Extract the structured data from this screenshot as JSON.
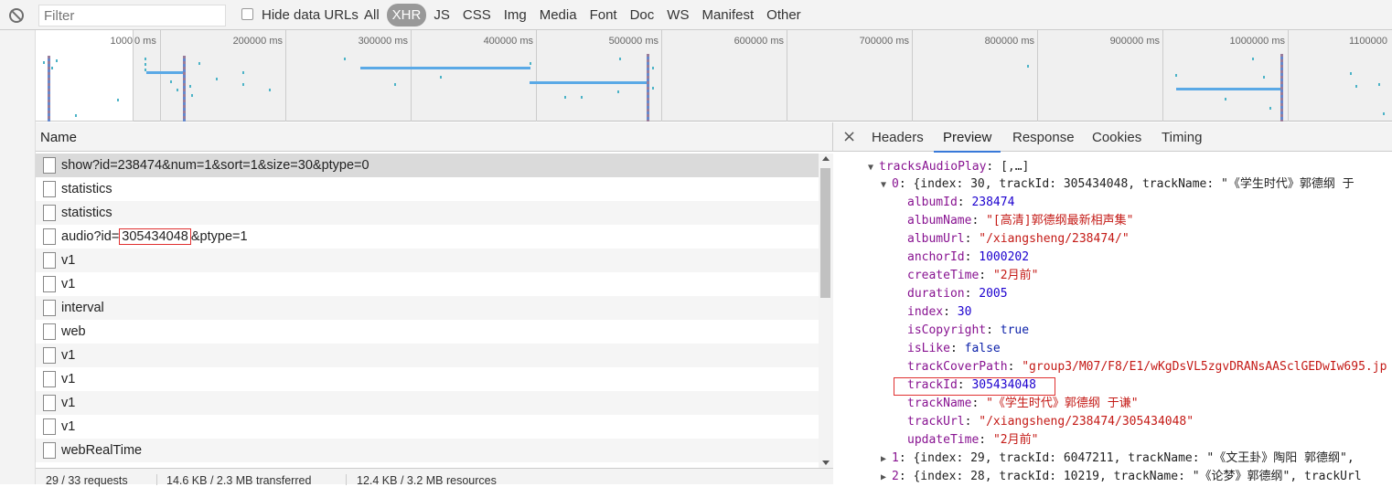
{
  "filterbar": {
    "placeholder": "Filter",
    "hide_label": "Hide data URLs",
    "types": [
      "All",
      "XHR",
      "JS",
      "CSS",
      "Img",
      "Media",
      "Font",
      "Doc",
      "WS",
      "Manifest",
      "Other"
    ],
    "active_type": "XHR"
  },
  "overview": {
    "ticks": [
      "1000",
      "0 ms",
      "200000 ms",
      "300000 ms",
      "400000 ms",
      "500000 ms",
      "600000 ms",
      "700000 ms",
      "800000 ms",
      "900000 ms",
      "1000000 ms",
      "1100000"
    ]
  },
  "list": {
    "column": "Name",
    "rows": [
      {
        "name": "show?id=238474&num=1&sort=1&size=30&ptype=0"
      },
      {
        "name": "statistics"
      },
      {
        "name": "statistics"
      },
      {
        "name_prefix": "audio?id=",
        "name_highlight": "305434048",
        "name_suffix": "&ptype=1"
      },
      {
        "name": "v1"
      },
      {
        "name": "v1"
      },
      {
        "name": "interval"
      },
      {
        "name": "web"
      },
      {
        "name": "v1"
      },
      {
        "name": "v1"
      },
      {
        "name": "v1"
      },
      {
        "name": "v1"
      },
      {
        "name": "webRealTime"
      }
    ],
    "status": {
      "requests": "29 / 33 requests",
      "transferred": "14.6 KB / 2.3 MB transferred",
      "resources": "12.4 KB / 3.2 MB resources"
    }
  },
  "panel": {
    "tabs": [
      "Headers",
      "Preview",
      "Response",
      "Cookies",
      "Timing"
    ],
    "active_tab": "Preview",
    "close": "×",
    "root_key": "tracksAudioPlay",
    "root_val": "[,…]",
    "item0": {
      "key": "0",
      "summary": "{index: 30, trackId: 305434048, trackName: \"《学生时代》郭德纲 于"
    },
    "fields": [
      {
        "key": "albumId",
        "val": "238474",
        "type": "n"
      },
      {
        "key": "albumName",
        "val": "\"[高清]郭德纲最新相声集\"",
        "type": "s"
      },
      {
        "key": "albumUrl",
        "val": "\"/xiangsheng/238474/\"",
        "type": "s"
      },
      {
        "key": "anchorId",
        "val": "1000202",
        "type": "n"
      },
      {
        "key": "createTime",
        "val": "\"2月前\"",
        "type": "s"
      },
      {
        "key": "duration",
        "val": "2005",
        "type": "n"
      },
      {
        "key": "index",
        "val": "30",
        "type": "n"
      },
      {
        "key": "isCopyright",
        "val": "true",
        "type": "b"
      },
      {
        "key": "isLike",
        "val": "false",
        "type": "b"
      },
      {
        "key": "trackCoverPath",
        "val": "\"group3/M07/F8/E1/wKgDsVL5zgvDRANsAASclGEDwIw695.jp",
        "type": "s"
      },
      {
        "key": "trackId",
        "val": "305434048",
        "type": "n"
      },
      {
        "key": "trackName",
        "val": "\"《学生时代》郭德纲 于谦\"",
        "type": "s"
      },
      {
        "key": "trackUrl",
        "val": "\"/xiangsheng/238474/305434048\"",
        "type": "s"
      },
      {
        "key": "updateTime",
        "val": "\"2月前\"",
        "type": "s"
      }
    ],
    "item1": {
      "key": "1",
      "summary": "{index: 29, trackId: 6047211, trackName: \"《文王卦》陶阳 郭德纲\","
    },
    "item2": {
      "key": "2",
      "summary": "{index: 28, trackId: 10219, trackName: \"《论梦》郭德纲\", trackUrl"
    }
  }
}
